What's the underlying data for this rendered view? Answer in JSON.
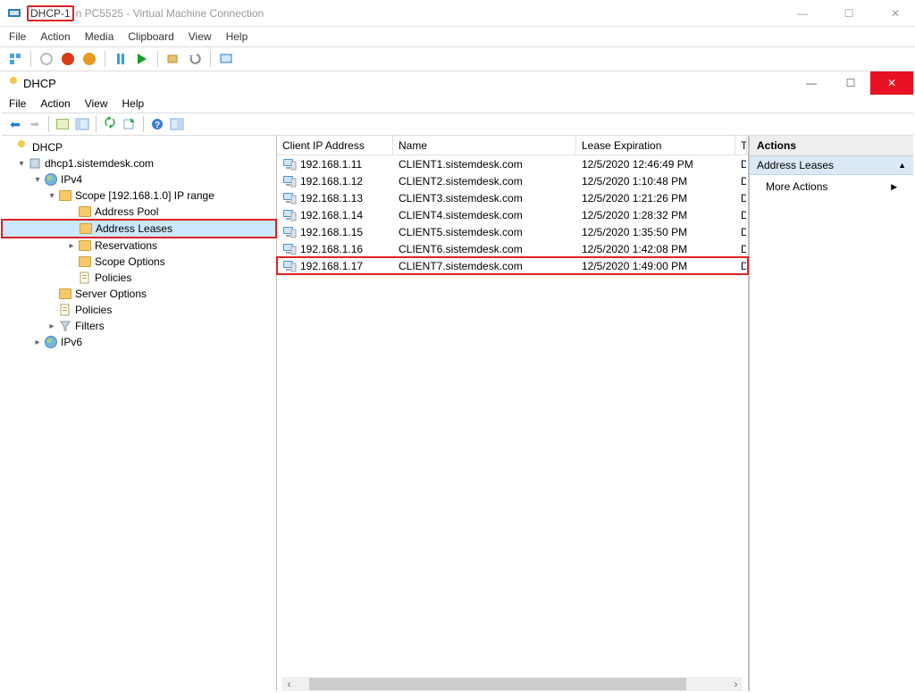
{
  "vm": {
    "title_highlight": "DHCP-1",
    "title_rest": "n PC5525 - Virtual Machine Connection",
    "menu": [
      "File",
      "Action",
      "Media",
      "Clipboard",
      "View",
      "Help"
    ]
  },
  "dhcp": {
    "title": "DHCP",
    "menu": [
      "File",
      "Action",
      "View",
      "Help"
    ]
  },
  "tree": {
    "root": "DHCP",
    "server": "dhcp1.sistemdesk.com",
    "ipv4": "IPv4",
    "scope": "Scope [192.168.1.0] IP range",
    "address_pool": "Address Pool",
    "address_leases": "Address Leases",
    "reservations": "Reservations",
    "scope_options": "Scope Options",
    "scope_policies": "Policies",
    "server_options": "Server Options",
    "policies": "Policies",
    "filters": "Filters",
    "ipv6": "IPv6"
  },
  "list": {
    "headers": {
      "ip": "Client IP Address",
      "name": "Name",
      "lease": "Lease Expiration",
      "trunc": "T"
    },
    "rows": [
      {
        "ip": "192.168.1.11",
        "name": "CLIENT1.sistemdesk.com",
        "lease": "12/5/2020 12:46:49 PM",
        "end": "D",
        "hl": false
      },
      {
        "ip": "192.168.1.12",
        "name": "CLIENT2.sistemdesk.com",
        "lease": "12/5/2020 1:10:48 PM",
        "end": "D",
        "hl": false
      },
      {
        "ip": "192.168.1.13",
        "name": "CLIENT3.sistemdesk.com",
        "lease": "12/5/2020 1:21:26 PM",
        "end": "D",
        "hl": false
      },
      {
        "ip": "192.168.1.14",
        "name": "CLIENT4.sistemdesk.com",
        "lease": "12/5/2020 1:28:32 PM",
        "end": "D",
        "hl": false
      },
      {
        "ip": "192.168.1.15",
        "name": "CLIENT5.sistemdesk.com",
        "lease": "12/5/2020 1:35:50 PM",
        "end": "D",
        "hl": false
      },
      {
        "ip": "192.168.1.16",
        "name": "CLIENT6.sistemdesk.com",
        "lease": "12/5/2020 1:42:08 PM",
        "end": "D",
        "hl": false
      },
      {
        "ip": "192.168.1.17",
        "name": "CLIENT7.sistemdesk.com",
        "lease": "12/5/2020 1:49:00 PM",
        "end": "D",
        "hl": true
      }
    ]
  },
  "actions": {
    "header": "Actions",
    "subheader": "Address Leases",
    "more": "More Actions"
  },
  "glyphs": {
    "min": "—",
    "max": "☐",
    "close": "✕",
    "up": "▲",
    "right": "▶",
    "left": "‹",
    "rightc": "›"
  }
}
